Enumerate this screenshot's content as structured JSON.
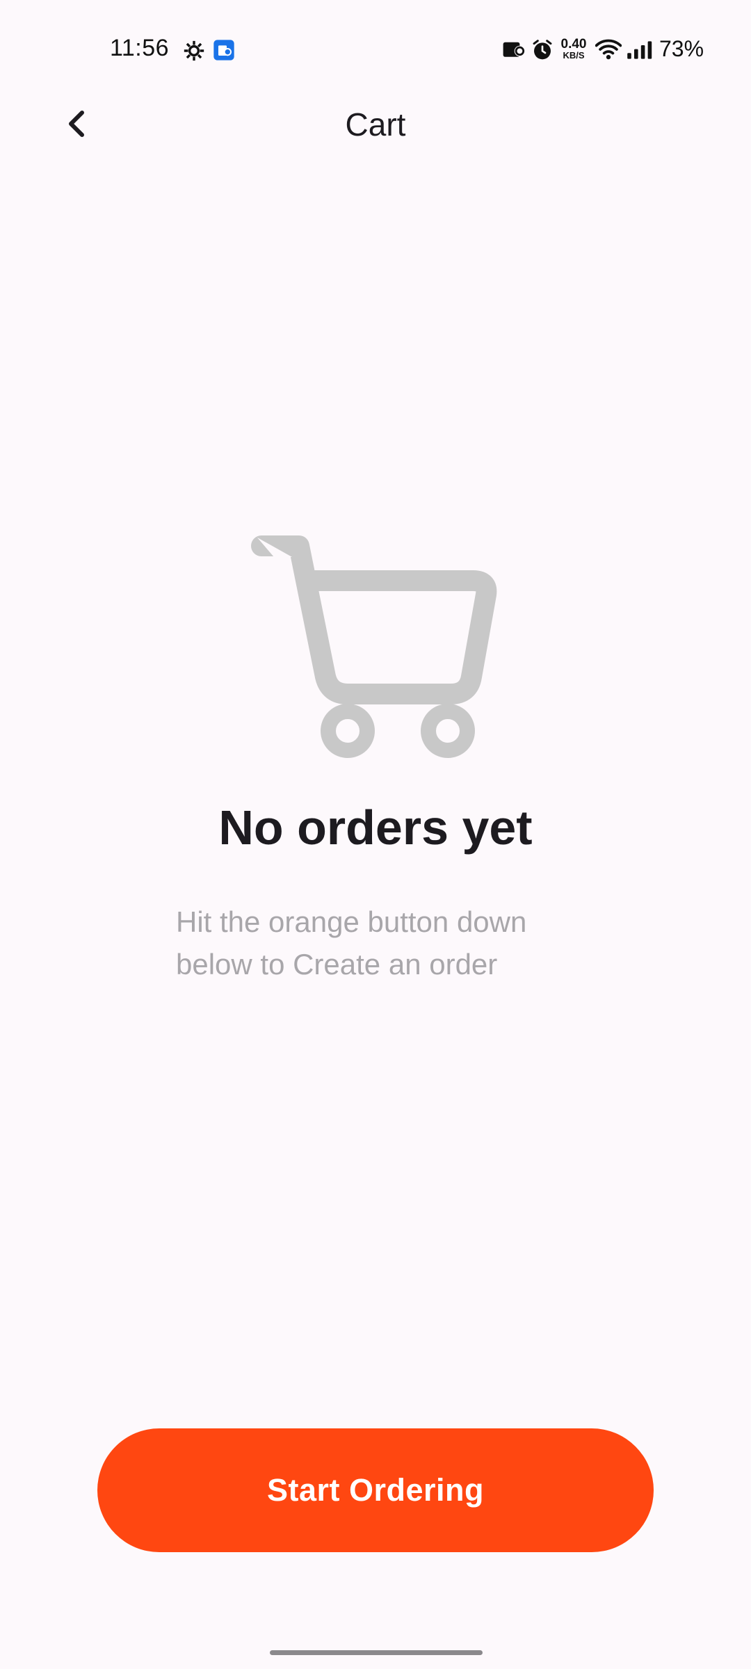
{
  "status_bar": {
    "time": "11:56",
    "net_speed_value": "0.40",
    "net_speed_unit": "KB/S",
    "battery": "73%",
    "icons": [
      "settings-gear-icon",
      "app-notification-icon",
      "nfc-card-icon",
      "alarm-icon",
      "wifi-icon",
      "cellular-signal-icon"
    ]
  },
  "header": {
    "back_icon": "chevron-left-icon",
    "title": "Cart"
  },
  "empty_state": {
    "icon": "shopping-cart-icon",
    "title": "No orders yet",
    "subtitle": "Hit the orange button down below to Create an order"
  },
  "cta": {
    "label": "Start Ordering"
  },
  "colors": {
    "background": "#FDF9FC",
    "accent": "#FF4711",
    "illustration": "#C8C8C8",
    "subtitle": "#A8A6AA"
  }
}
